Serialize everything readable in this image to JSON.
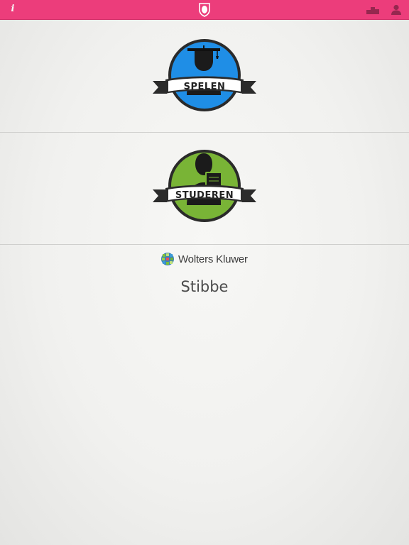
{
  "topbar": {
    "info_label": "i",
    "info_icon": "info-icon",
    "logo_icon": "shield-logo-icon",
    "leaderboard_icon": "podium-icon",
    "profile_icon": "person-icon",
    "color": "#ec3d7b"
  },
  "modes": [
    {
      "label": "SPELEN",
      "icon": "graduate-icon",
      "color": "#1f8ee6"
    },
    {
      "label": "STUDEREN",
      "icon": "reader-icon",
      "color": "#79b436"
    }
  ],
  "publisher": {
    "name": "Wolters Kluwer",
    "icon": "wolters-kluwer-globe-icon",
    "imprint": "Stibbe"
  }
}
